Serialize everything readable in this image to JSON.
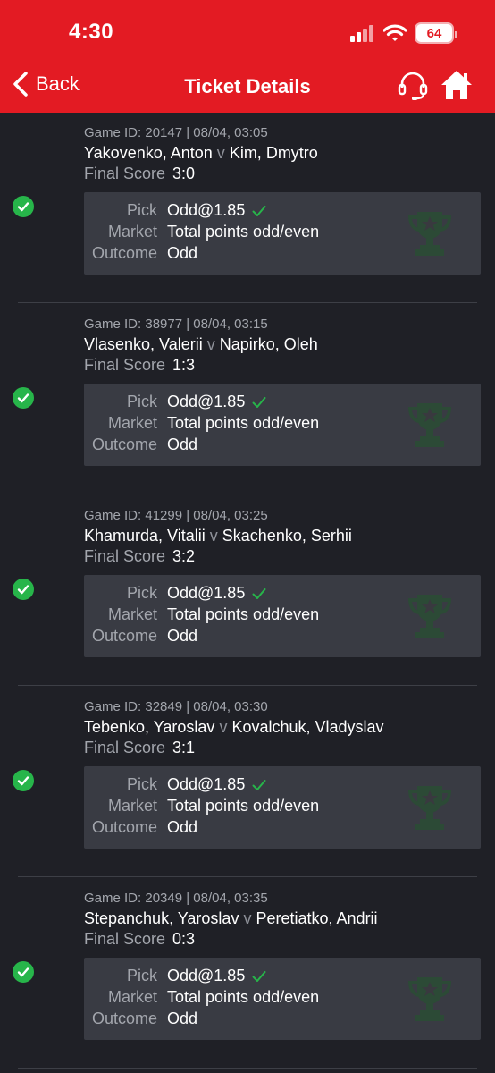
{
  "status_bar": {
    "time": "4:30",
    "battery": "64"
  },
  "nav": {
    "back_label": "Back",
    "title": "Ticket Details"
  },
  "labels": {
    "final_score": "Final Score",
    "pick": "Pick",
    "market": "Market",
    "outcome": "Outcome",
    "vs": "v"
  },
  "colors": {
    "header": "#e31b23",
    "background": "#1f2026",
    "card": "#393b43",
    "win": "#27b54a"
  },
  "tickets": [
    {
      "game_id": "Game ID: 20147 | 08/04, 03:05",
      "player1": "Yakovenko, Anton",
      "player2": "Kim, Dmytro",
      "score": "3:0",
      "pick": "Odd@1.85",
      "market": "Total points odd/even",
      "outcome": "Odd",
      "status_icon": "check-circle-icon"
    },
    {
      "game_id": "Game ID: 38977 | 08/04, 03:15",
      "player1": "Vlasenko, Valerii",
      "player2": "Napirko, Oleh",
      "score": "1:3",
      "pick": "Odd@1.85",
      "market": "Total points odd/even",
      "outcome": "Odd",
      "status_icon": "check-circle-icon"
    },
    {
      "game_id": "Game ID: 41299 | 08/04, 03:25",
      "player1": "Khamurda, Vitalii",
      "player2": "Skachenko, Serhii",
      "score": "3:2",
      "pick": "Odd@1.85",
      "market": "Total points odd/even",
      "outcome": "Odd",
      "status_icon": "check-circle-icon"
    },
    {
      "game_id": "Game ID: 32849 | 08/04, 03:30",
      "player1": "Tebenko, Yaroslav",
      "player2": "Kovalchuk, Vladyslav",
      "score": "3:1",
      "pick": "Odd@1.85",
      "market": "Total points odd/even",
      "outcome": "Odd",
      "status_icon": "check-circle-icon"
    },
    {
      "game_id": "Game ID: 20349 | 08/04, 03:35",
      "player1": "Stepanchuk, Yaroslav",
      "player2": "Peretiatko, Andrii",
      "score": "0:3",
      "pick": "Odd@1.85",
      "market": "Total points odd/even",
      "outcome": "Odd",
      "status_icon": "check-circle-icon"
    }
  ]
}
